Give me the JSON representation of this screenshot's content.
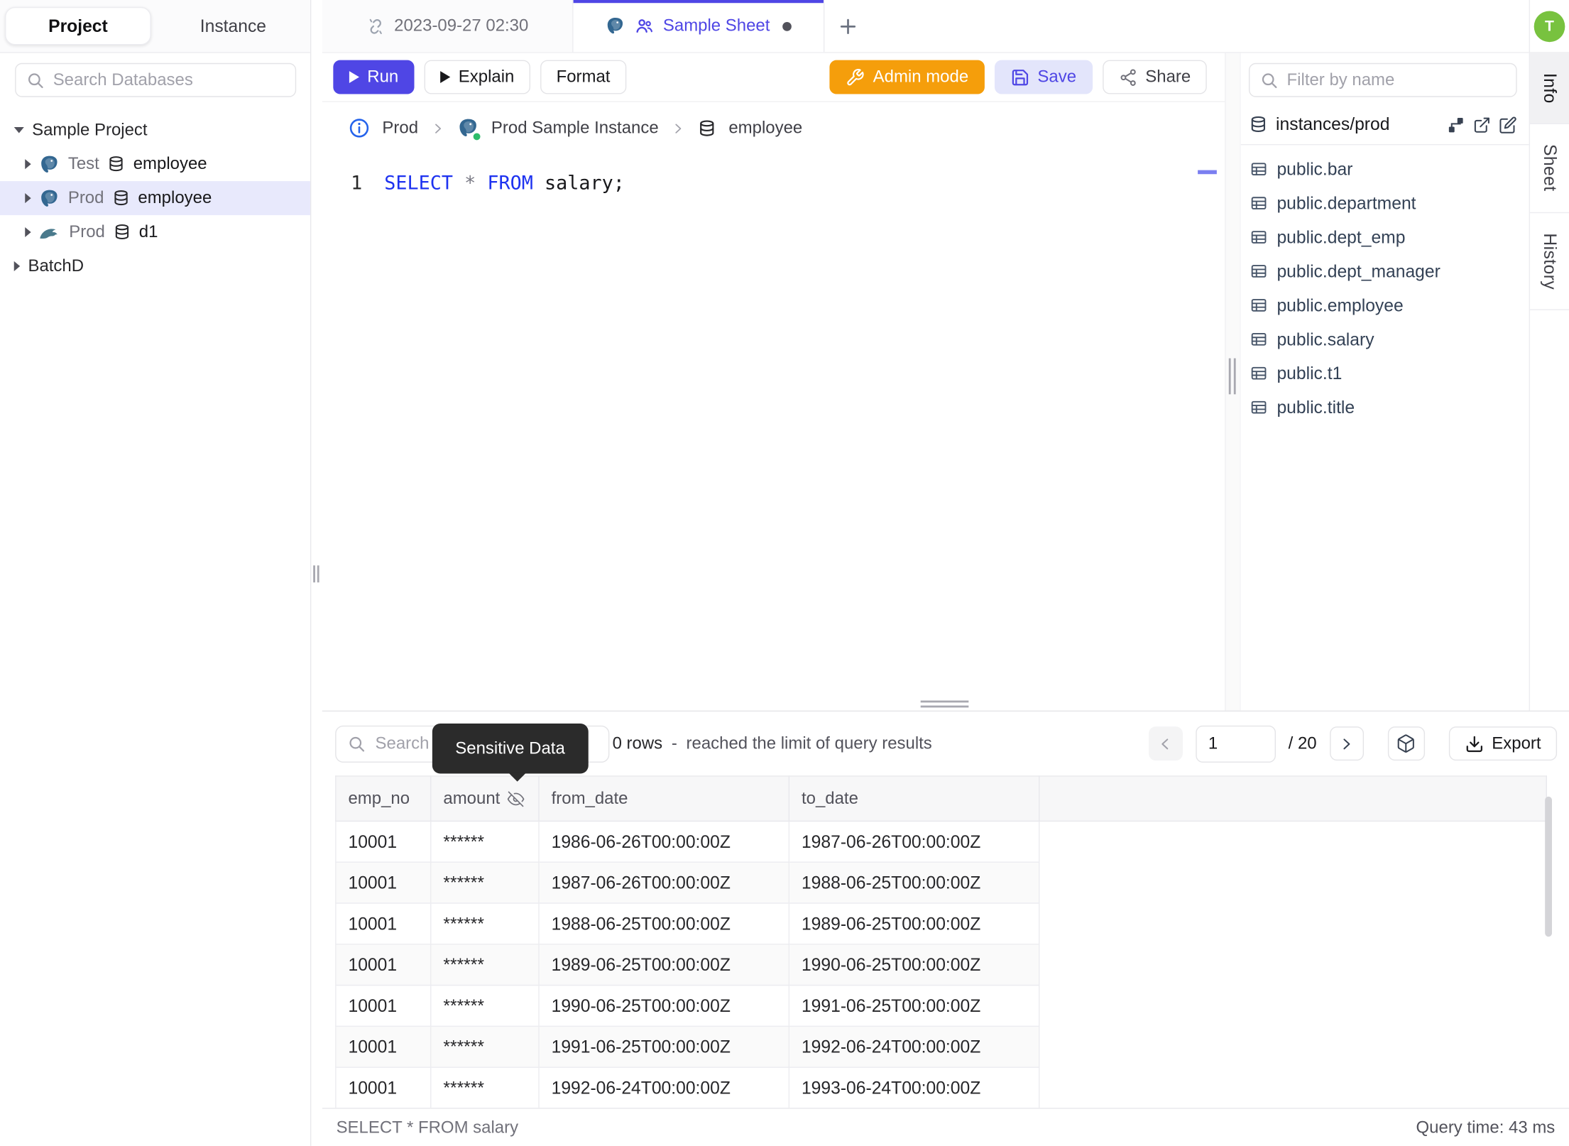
{
  "colors": {
    "accent": "#4f46e5",
    "accent-soft": "#e3e5fb",
    "warning": "#f59e0b",
    "avatar": "#78c23f",
    "kw": "#1d32f0",
    "select-bg": "#e8e9fc",
    "tooltip-bg": "#2b2b2b",
    "status-green": "#2ebd6b"
  },
  "left_tabs": {
    "project": "Project",
    "instance": "Instance"
  },
  "sidebar": {
    "search_placeholder": "Search Databases",
    "project_label": "Sample Project",
    "items": [
      {
        "env": "Test",
        "name": "employee",
        "engine": "postgresql"
      },
      {
        "env": "Prod",
        "name": "employee",
        "engine": "postgresql"
      },
      {
        "env": "Prod",
        "name": "d1",
        "engine": "mysql"
      }
    ],
    "batch_label": "BatchD"
  },
  "sheet_tabs": {
    "temp": "2023-09-27 02:30",
    "active": "Sample Sheet"
  },
  "toolbar": {
    "run": "Run",
    "explain": "Explain",
    "format": "Format",
    "admin": "Admin mode",
    "save": "Save",
    "share": "Share"
  },
  "breadcrumb": {
    "env": "Prod",
    "instance": "Prod Sample Instance",
    "database": "employee"
  },
  "editor": {
    "line": "1",
    "kw1": "SELECT",
    "star": " * ",
    "kw2": "FROM",
    "rest": " salary;"
  },
  "right_panel": {
    "filter_placeholder": "Filter by name",
    "header": "instances/prod",
    "tables": [
      "public.bar",
      "public.department",
      "public.dept_emp",
      "public.dept_manager",
      "public.employee",
      "public.salary",
      "public.t1",
      "public.title"
    ]
  },
  "side_tabs": [
    "Info",
    "Sheet",
    "History"
  ],
  "avatar": {
    "initial": "T"
  },
  "results": {
    "search_placeholder": "Search",
    "tooltip": "Sensitive Data",
    "rows_count": "0 rows",
    "dash": "-",
    "limit_message": "reached the limit of query results",
    "page": "1",
    "page_total": "/ 20",
    "export": "Export",
    "columns": [
      "emp_no",
      "amount",
      "from_date",
      "to_date"
    ],
    "rows": [
      [
        "10001",
        "******",
        "1986-06-26T00:00:00Z",
        "1987-06-26T00:00:00Z"
      ],
      [
        "10001",
        "******",
        "1987-06-26T00:00:00Z",
        "1988-06-25T00:00:00Z"
      ],
      [
        "10001",
        "******",
        "1988-06-25T00:00:00Z",
        "1989-06-25T00:00:00Z"
      ],
      [
        "10001",
        "******",
        "1989-06-25T00:00:00Z",
        "1990-06-25T00:00:00Z"
      ],
      [
        "10001",
        "******",
        "1990-06-25T00:00:00Z",
        "1991-06-25T00:00:00Z"
      ],
      [
        "10001",
        "******",
        "1991-06-25T00:00:00Z",
        "1992-06-24T00:00:00Z"
      ],
      [
        "10001",
        "******",
        "1992-06-24T00:00:00Z",
        "1993-06-24T00:00:00Z"
      ]
    ]
  },
  "statusbar": {
    "left": "SELECT * FROM salary",
    "right": "Query time: 43 ms"
  }
}
